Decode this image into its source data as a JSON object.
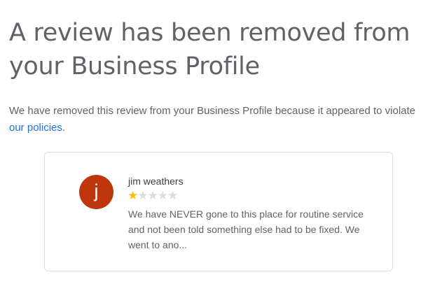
{
  "header": {
    "title": "A review has been removed from your Business Profile"
  },
  "notice": {
    "text_before_link": "We have removed this review from your Business Profile because it appeared to violate ",
    "link_text": "our policies",
    "text_after_link": "."
  },
  "review": {
    "avatar_letter": "j",
    "avatar_color": "#bf360c",
    "reviewer_name": "jim weathers",
    "rating": 1,
    "max_rating": 5,
    "star_filled_color": "#fbbc04",
    "star_empty_color": "#dadce0",
    "text": "We have NEVER gone to this place for routine service and not been told something else had to be fixed. We went to ano..."
  },
  "colors": {
    "link": "#1a73e8",
    "headline": "#5f6368"
  }
}
